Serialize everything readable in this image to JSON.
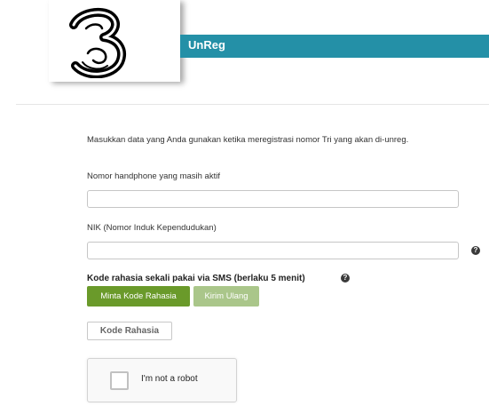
{
  "header": {
    "title": "UnReg"
  },
  "logo": {
    "icon": "three-logo-icon"
  },
  "form": {
    "intro": "Masukkan data yang Anda gunakan ketika meregistrasi nomor Tri yang akan di-unreg.",
    "phone_label": "Nomor handphone yang masih aktif",
    "phone_value": "",
    "nik_label": "NIK (Nomor Induk Kependudukan)",
    "nik_value": "",
    "help_glyph": "?",
    "kode_label": "Kode rahasia sekali pakai via SMS (berlaku 5 menit)",
    "minta_button": "Minta Kode Rahasia",
    "kirim_button": "Kirim Ulang",
    "kode_button": "Kode Rahasia"
  },
  "captcha": {
    "label": "I'm not a robot"
  },
  "colors": {
    "title_bar": "#2490a7",
    "button_primary": "#6a9a2a",
    "button_disabled": "#aac68a"
  }
}
